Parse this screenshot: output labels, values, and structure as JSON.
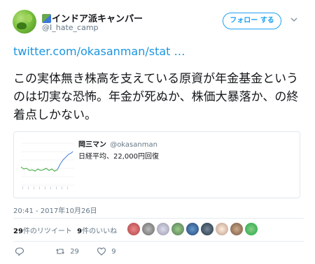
{
  "user": {
    "display_name": "インドア派キャンパー",
    "handle": "@I_hate_camp",
    "avatar_icon": "plant-avatar-icon",
    "name_icon": "camping-emoji-icon"
  },
  "follow_button": {
    "label": "フォロー する"
  },
  "tweet": {
    "link_text": "twitter.com/okasanman/stat …",
    "text": "この実体無き株高を支えている原資が年金基金というのは切実な恐怖。年金が死ぬか、株価大暴落か、の終着点しかない。",
    "timestamp": "20:41 - 2017年10月26日"
  },
  "quoted_card": {
    "display_name": "岡三マン",
    "handle": "@okasanman",
    "text": "日経平均、22,000円回復"
  },
  "stats": {
    "retweets_count": "29",
    "retweets_label": "件のリツイート",
    "likes_count": "9",
    "likes_label": "件のいいね"
  },
  "actions": {
    "retweet_count": "29",
    "like_count": "9"
  },
  "colors": {
    "accent": "#1da1f2",
    "link": "#1b95e0",
    "muted": "#657786",
    "border": "#e1e8ed"
  }
}
